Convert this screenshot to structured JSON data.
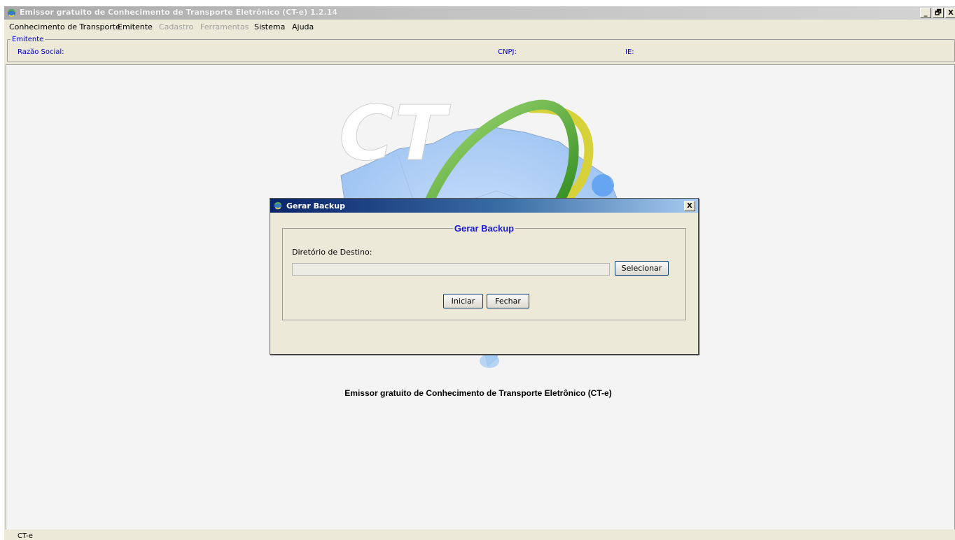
{
  "window": {
    "title": "Emissor gratuito de Conhecimento de Transporte Eletrônico (CT-e) 1.2.14",
    "controls": [
      "_",
      "🗗",
      "X"
    ]
  },
  "menubar": {
    "items": [
      {
        "label": "Conhecimento de Transporte",
        "enabled": true
      },
      {
        "label": "Emitente",
        "enabled": true
      },
      {
        "label": "Cadastro",
        "enabled": false
      },
      {
        "label": "Ferramentas",
        "enabled": false
      },
      {
        "label": "Sistema",
        "enabled": true
      },
      {
        "label": "Ajuda",
        "enabled": true
      }
    ]
  },
  "emitente": {
    "legend": "Emitente",
    "razao_social_label": "Razão Social:",
    "cnpj_label": "CNPJ:",
    "ie_label": "IE:"
  },
  "content": {
    "logo_text": "CT",
    "caption": "Emissor gratuito de Conhecimento de Transporte Eletrônico (CT-e)"
  },
  "statusbar": {
    "text": "CT-e"
  },
  "dialog": {
    "title": "Gerar Backup",
    "close_label": "X",
    "group_title": "Gerar Backup",
    "dir_label": "Diretório de Destino:",
    "dir_value": "",
    "select_button": "Selecionar",
    "start_button": "Iniciar",
    "close_button": "Fechar"
  },
  "colors": {
    "accent_blue": "#1a1ad0",
    "label_blue": "#0000cc",
    "dialog_title_start": "#0a246a",
    "dialog_title_end": "#a6caf0",
    "window_bg": "#ece9d8"
  }
}
